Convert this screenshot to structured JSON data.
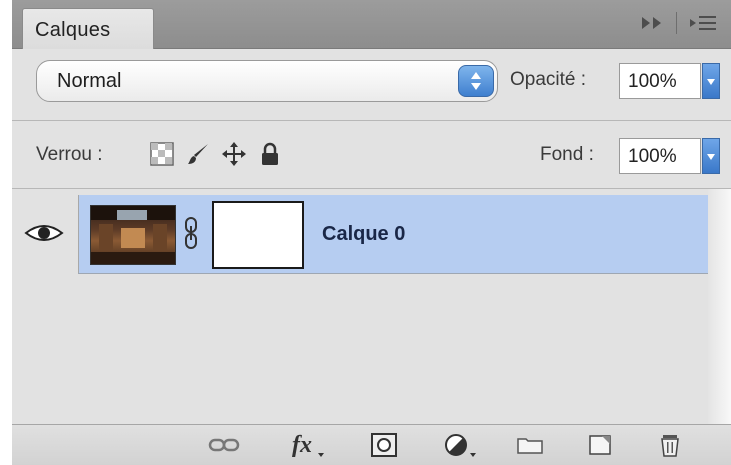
{
  "panel": {
    "tab_label": "Calques",
    "icons": {
      "collapse": "double-arrow-icon",
      "menu": "panel-menu-icon"
    }
  },
  "blend": {
    "mode": "Normal",
    "opacity_label": "Opacité :",
    "opacity_value": "100%"
  },
  "lock": {
    "label": "Verrou :",
    "icons": [
      "lock-transparency-icon",
      "lock-pixels-icon",
      "lock-position-icon",
      "lock-all-icon"
    ],
    "fill_label": "Fond :",
    "fill_value": "100%"
  },
  "layers": [
    {
      "name": "Calque 0",
      "visible": true,
      "selected": true,
      "has_mask": true
    }
  ],
  "bottom_bar": {
    "icons": [
      "link-layers-icon",
      "fx-icon",
      "add-mask-icon",
      "adjustment-layer-icon",
      "new-group-icon",
      "new-layer-icon",
      "delete-icon"
    ]
  },
  "colors": {
    "selection": "#b6cdf1",
    "panel_bg": "#e2e2e2",
    "tab_bar": "#969696",
    "accent_blue": "#4a86d6"
  }
}
